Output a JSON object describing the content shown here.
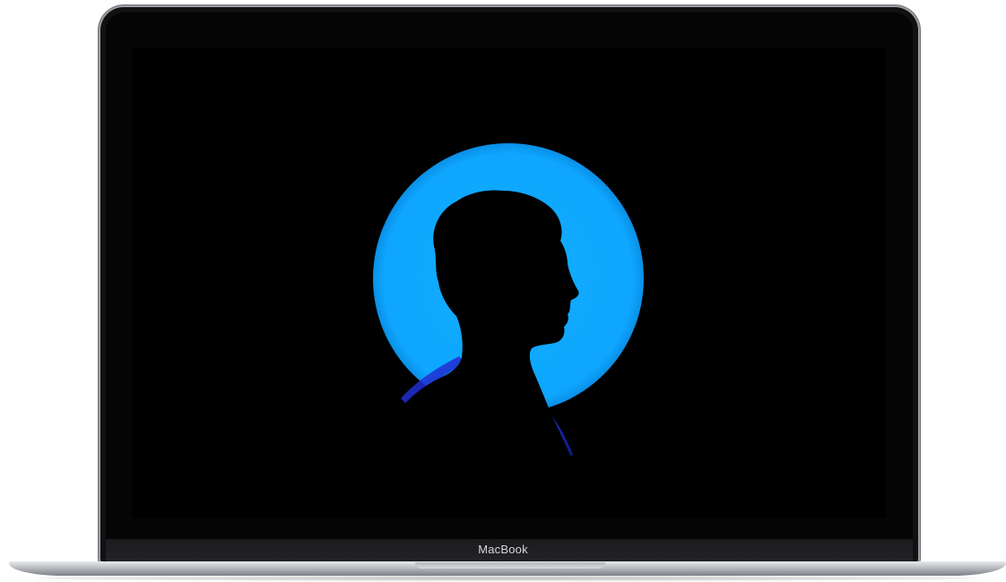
{
  "device": {
    "brand_label": "MacBook"
  },
  "screen": {
    "image": "silhouette-portrait",
    "colors": {
      "background": "#000000",
      "halo": "#0fa6ff",
      "rim_light": "#2a3cff"
    }
  }
}
